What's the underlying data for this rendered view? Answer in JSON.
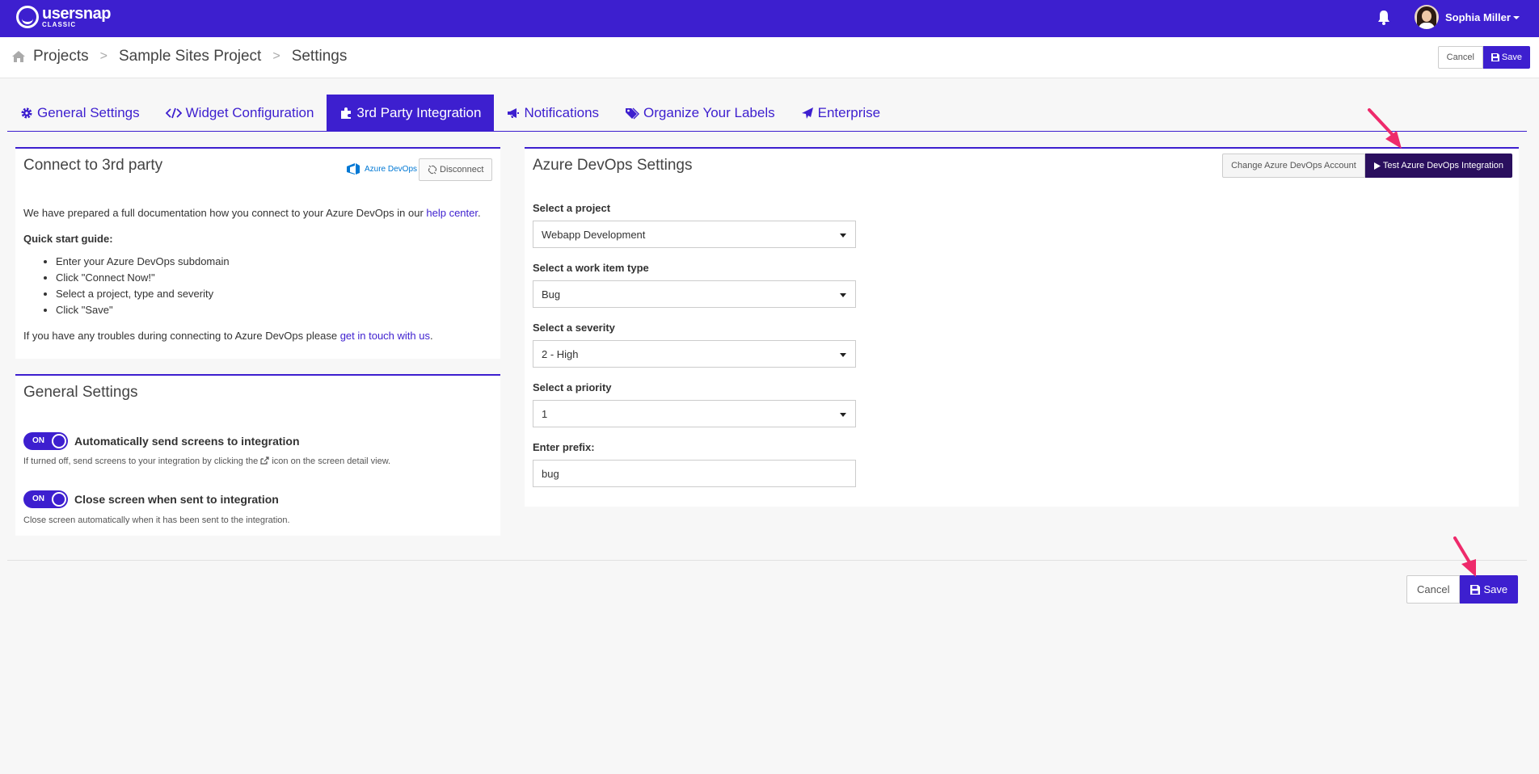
{
  "brand": {
    "name": "usersnap",
    "tagline": "CLASSIC"
  },
  "user": {
    "name": "Sophia Miller"
  },
  "breadcrumb": [
    "Projects",
    "Sample Sites Project",
    "Settings"
  ],
  "breadcrumb_sep": ">",
  "top_actions": {
    "cancel": "Cancel",
    "save": "Save"
  },
  "tabs": [
    {
      "label": "General Settings",
      "icon": "gear-icon"
    },
    {
      "label": "Widget Configuration",
      "icon": "code-icon"
    },
    {
      "label": "3rd Party Integration",
      "icon": "puzzle-icon",
      "active": true
    },
    {
      "label": "Notifications",
      "icon": "megaphone-icon"
    },
    {
      "label": "Organize Your Labels",
      "icon": "tags-icon"
    },
    {
      "label": "Enterprise",
      "icon": "plane-icon"
    }
  ],
  "connect": {
    "title": "Connect to 3rd party",
    "provider": "Azure DevOps",
    "disconnect": "Disconnect",
    "doc_text": "We have prepared a full documentation how you connect to your Azure DevOps in our ",
    "doc_link": "help center",
    "doc_end": ".",
    "quick_title": "Quick start guide:",
    "steps": [
      "Enter your Azure DevOps subdomain",
      "Click \"Connect Now!\"",
      "Select a project, type and severity",
      "Click \"Save\""
    ],
    "trouble_text": "If you have any troubles during connecting to Azure DevOps please ",
    "trouble_link": "get in touch with us",
    "trouble_end": "."
  },
  "general": {
    "title": "General Settings",
    "toggle_on": "ON",
    "auto_send_label": "Automatically send screens to integration",
    "auto_send_help_a": "If turned off, send screens to your integration by clicking the ",
    "auto_send_help_b": " icon on the screen detail view.",
    "close_label": "Close screen when sent to integration",
    "close_help": "Close screen automatically when it has been sent to the integration."
  },
  "azure": {
    "title": "Azure DevOps Settings",
    "change_account": "Change Azure DevOps Account",
    "test": "Test Azure DevOps Integration",
    "project_label": "Select a project",
    "project_value": "Webapp Development",
    "type_label": "Select a work item type",
    "type_value": "Bug",
    "severity_label": "Select a severity",
    "severity_value": "2 - High",
    "priority_label": "Select a priority",
    "priority_value": "1",
    "prefix_label": "Enter prefix:",
    "prefix_value": "bug"
  },
  "bottom_actions": {
    "cancel": "Cancel",
    "save": "Save"
  },
  "colors": {
    "brand": "#3d1fcf",
    "test_button": "#2a0f5e",
    "annotation_arrow": "#ee2a6b"
  }
}
